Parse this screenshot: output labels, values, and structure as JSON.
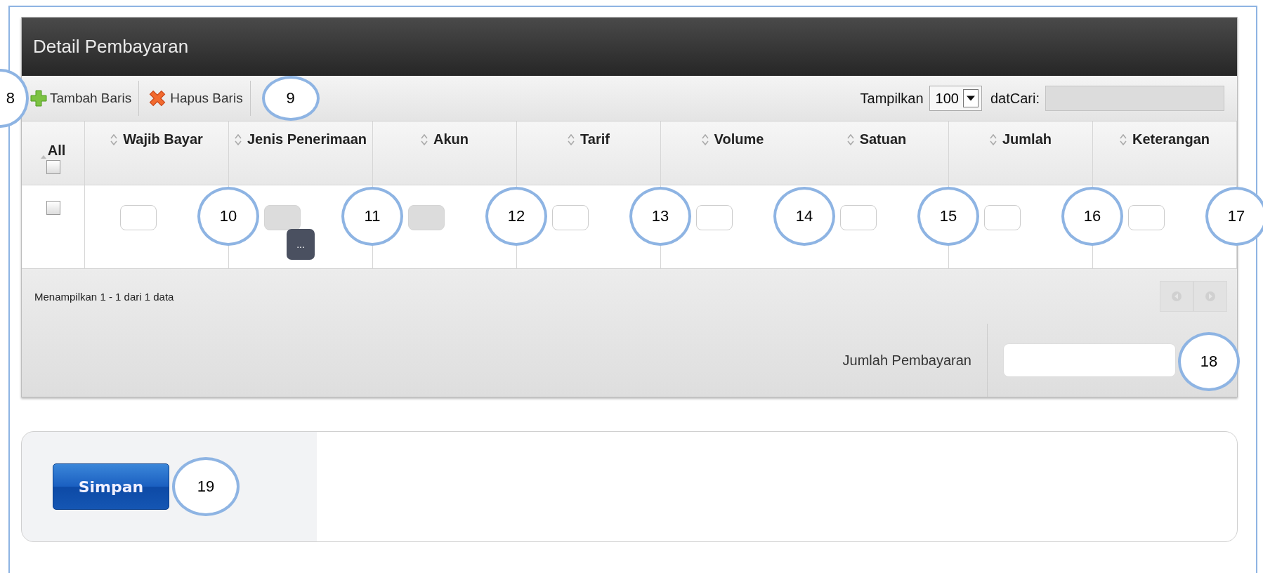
{
  "panel": {
    "title": "Detail Pembayaran"
  },
  "toolbar": {
    "buttons": [
      {
        "label": "Tambah Baris",
        "kind": "add",
        "callout": "8"
      },
      {
        "label": "Hapus Baris",
        "kind": "delete",
        "callout": "9"
      }
    ],
    "show_label": "Tampilkan",
    "page_size": "100",
    "show_suffix": "dat",
    "search_label": "Cari:"
  },
  "table": {
    "select_all_label": "All",
    "select_all_checked": false,
    "columns": [
      {
        "label": "Wajib Bayar"
      },
      {
        "label": "Jenis Penerimaan"
      },
      {
        "label": "Akun"
      },
      {
        "label": "Tarif"
      },
      {
        "label": "Volume"
      },
      {
        "label": "Satuan"
      },
      {
        "label": "Jumlah"
      },
      {
        "label": "Keterangan"
      }
    ],
    "rows": [
      {
        "checked": false,
        "cells": [
          {
            "kind": "text",
            "callout": "10"
          },
          {
            "kind": "lookup",
            "lookup_button": "...",
            "callout": "11"
          },
          {
            "kind": "readonly",
            "callout": "12"
          },
          {
            "kind": "text",
            "callout": "13"
          },
          {
            "kind": "text",
            "callout": "14"
          },
          {
            "kind": "text",
            "callout": "15"
          },
          {
            "kind": "text",
            "callout": "16"
          },
          {
            "kind": "text",
            "callout": "17"
          }
        ]
      }
    ]
  },
  "footer": {
    "info": "Menampilkan 1 - 1 dari 1 data"
  },
  "total": {
    "label": "Jumlah Pembayaran",
    "callout": "18"
  },
  "save": {
    "label": "Simpan",
    "callout": "19"
  }
}
